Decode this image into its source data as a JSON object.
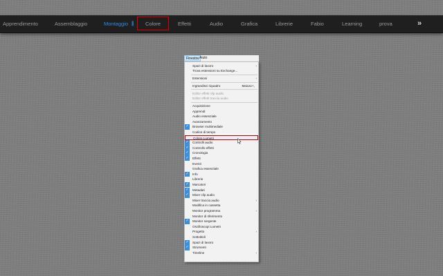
{
  "workspaces": {
    "tabs": [
      {
        "label": "Apprendimento"
      },
      {
        "label": "Assemblaggio"
      },
      {
        "label": "Montaggio",
        "active": true
      },
      {
        "label": "Colore",
        "highlighted": true
      },
      {
        "label": "Effetti"
      },
      {
        "label": "Audio"
      },
      {
        "label": "Grafica"
      },
      {
        "label": "Librerie"
      },
      {
        "label": "Fabio"
      },
      {
        "label": "Learning"
      },
      {
        "label": "prova"
      }
    ],
    "separator_glyph": "|||",
    "more_glyph": "»",
    "active_color": "#2d8ceb",
    "highlight_color": "#e00000"
  },
  "menubar": {
    "items": [
      {
        "label": "Finestra",
        "open": true
      },
      {
        "label": "Aiuto"
      }
    ]
  },
  "menu": {
    "items": [
      {
        "label": "Spazi di lavoro",
        "submenu": true
      },
      {
        "label": "Trova estensioni su Exchange..."
      },
      {
        "divider": true
      },
      {
        "label": "Estensioni",
        "submenu": true
      },
      {
        "divider": true
      },
      {
        "label": "Ingrandisci riquadro",
        "shortcut": "Maiusc+,"
      },
      {
        "divider": true
      },
      {
        "label": "Editor effetti clip audio",
        "disabled": true
      },
      {
        "label": "Editor effetti traccia audio",
        "disabled": true
      },
      {
        "divider": true
      },
      {
        "label": "Acquisizione"
      },
      {
        "label": "Apprendi"
      },
      {
        "label": "Audio essenziale"
      },
      {
        "label": "Avanzamento"
      },
      {
        "label": "Browser multimediale",
        "checked": true
      },
      {
        "label": "Codice di tempo"
      },
      {
        "label": "Colore Lumetri",
        "highlighted": true
      },
      {
        "label": "Controlli audio",
        "checked": true
      },
      {
        "label": "Controllo effetti",
        "checked": true
      },
      {
        "label": "Cronologia",
        "checked": true
      },
      {
        "label": "Effetti",
        "checked": true
      },
      {
        "label": "Eventi"
      },
      {
        "label": "Grafica essenziale"
      },
      {
        "label": "Info",
        "checked": true
      },
      {
        "label": "Librerie"
      },
      {
        "label": "Marcatori",
        "checked": true
      },
      {
        "label": "Metadati",
        "checked": true
      },
      {
        "label": "Mixer clip audio",
        "checked": true
      },
      {
        "label": "Mixer traccia audio",
        "submenu": true
      },
      {
        "label": "Modifica in cassetta"
      },
      {
        "label": "Monitor programma",
        "submenu": true
      },
      {
        "label": "Monitor di riferimento"
      },
      {
        "label": "Monitor sorgente",
        "checked": true
      },
      {
        "label": "Oscilloscopi Lumetri"
      },
      {
        "label": "Progetto",
        "submenu": true
      },
      {
        "label": "Sottotitoli"
      },
      {
        "label": "Spazi di lavoro",
        "checked": true
      },
      {
        "label": "Strumenti",
        "checked": true
      },
      {
        "label": "Timeline",
        "submenu": true
      }
    ],
    "check_glyph": "✓",
    "submenu_glyph": "›",
    "accent_color": "#3d8fd9"
  },
  "icons": {
    "cursor": "mouse-pointer-icon",
    "check": "checkmark-icon",
    "submenu": "submenu-arrow-icon",
    "more": "chevron-double-right-icon"
  }
}
